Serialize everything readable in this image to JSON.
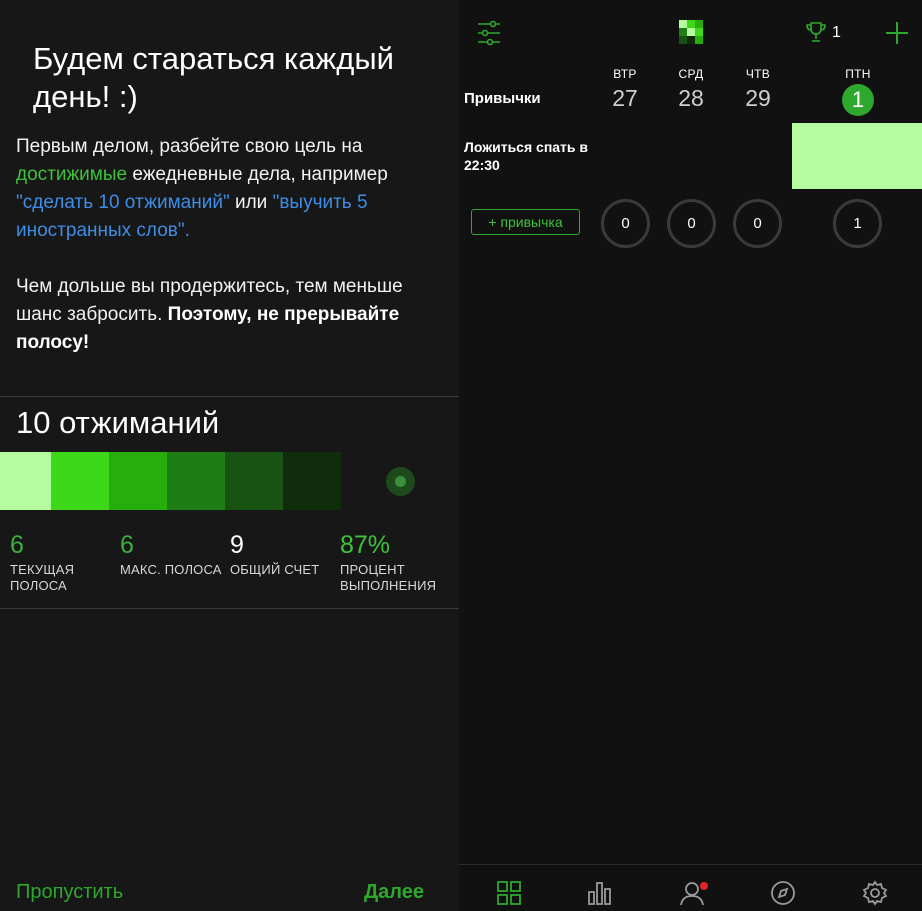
{
  "onboarding": {
    "title": "Будем стараться каждый день! :)",
    "intro": {
      "p1_part1": "Первым делом, разбейте свою цель на ",
      "p1_green": "достижимые",
      "p1_part2": " ежедневные дела, например ",
      "p1_blue1": "\"сделать 10 отжиманий\"",
      "p1_part3": " или ",
      "p1_blue2": "\"выучить 5 иностранных слов\".",
      "p2_part1": "Чем дольше вы продержитесь, тем меньше шанс забросить. ",
      "p2_bold": "Поэтому, не прерывайте полосу!"
    },
    "habit_title": "10 отжиманий",
    "swatch_colors": [
      "#b5fca0",
      "#3ed81b",
      "#27ae0d",
      "#1f7d15",
      "#185314",
      "#0f2d0b"
    ],
    "stats": [
      {
        "value": "6",
        "label": "ТЕКУЩАЯ ПОЛОСА",
        "color": "#3cae3c"
      },
      {
        "value": "6",
        "label": "МАКС. ПОЛОСА",
        "color": "#3cae3c"
      },
      {
        "value": "9",
        "label": "ОБЩИЙ СЧЕТ",
        "color": "#ffffff"
      },
      {
        "value": "87%",
        "label": "ПРОЦЕНТ ВЫПОЛНЕНИЯ",
        "color": "#3cc23c"
      }
    ],
    "skip_label": "Пропустить",
    "next_label": "Далее"
  },
  "tracker": {
    "header_label": "Привычки",
    "trophy_count": "1",
    "days": [
      {
        "abbr": "ВТР",
        "num": "27"
      },
      {
        "abbr": "СРД",
        "num": "28"
      },
      {
        "abbr": "ЧТВ",
        "num": "29"
      },
      {
        "abbr": "ПТН",
        "num": "1"
      }
    ],
    "habits": [
      {
        "name": "Ложиться спать в 22:30",
        "done_today": true
      }
    ],
    "add_habit_label": "+ привычка",
    "counts": [
      "0",
      "0",
      "0",
      "1"
    ],
    "icons": {
      "top": [
        "filter-icon",
        "logo-icon",
        "trophy-icon",
        "plus-icon"
      ],
      "nav": [
        "grid-icon",
        "bar-chart-icon",
        "profile-icon",
        "compass-icon",
        "gear-icon"
      ]
    },
    "colors": {
      "accent": "#2da82d",
      "done_cell": "#b5fca0",
      "notification": "#e0242a"
    }
  }
}
